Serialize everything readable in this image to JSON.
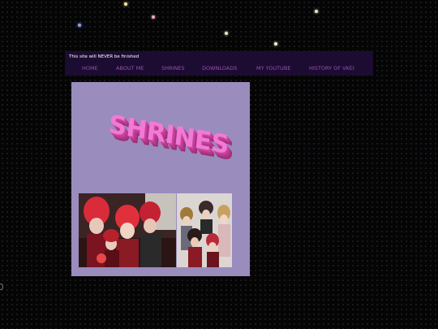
{
  "header": {
    "notice": "This site will NEVER be finished"
  },
  "nav": {
    "items": [
      {
        "label": "HOME"
      },
      {
        "label": "ABOUT ME"
      },
      {
        "label": "SHRINES"
      },
      {
        "label": "DOWNLOADS"
      },
      {
        "label": "MY YOUTUBE"
      },
      {
        "label": "HISTORY OF VKEI"
      }
    ]
  },
  "content": {
    "title_graphic": "SHRINES"
  },
  "colors": {
    "page_bg": "#050505",
    "header_bg": "#1c0c32",
    "nav_link": "#9b4fb0",
    "content_bg": "#9a8cbd",
    "title_pink": "#f27ad6"
  }
}
